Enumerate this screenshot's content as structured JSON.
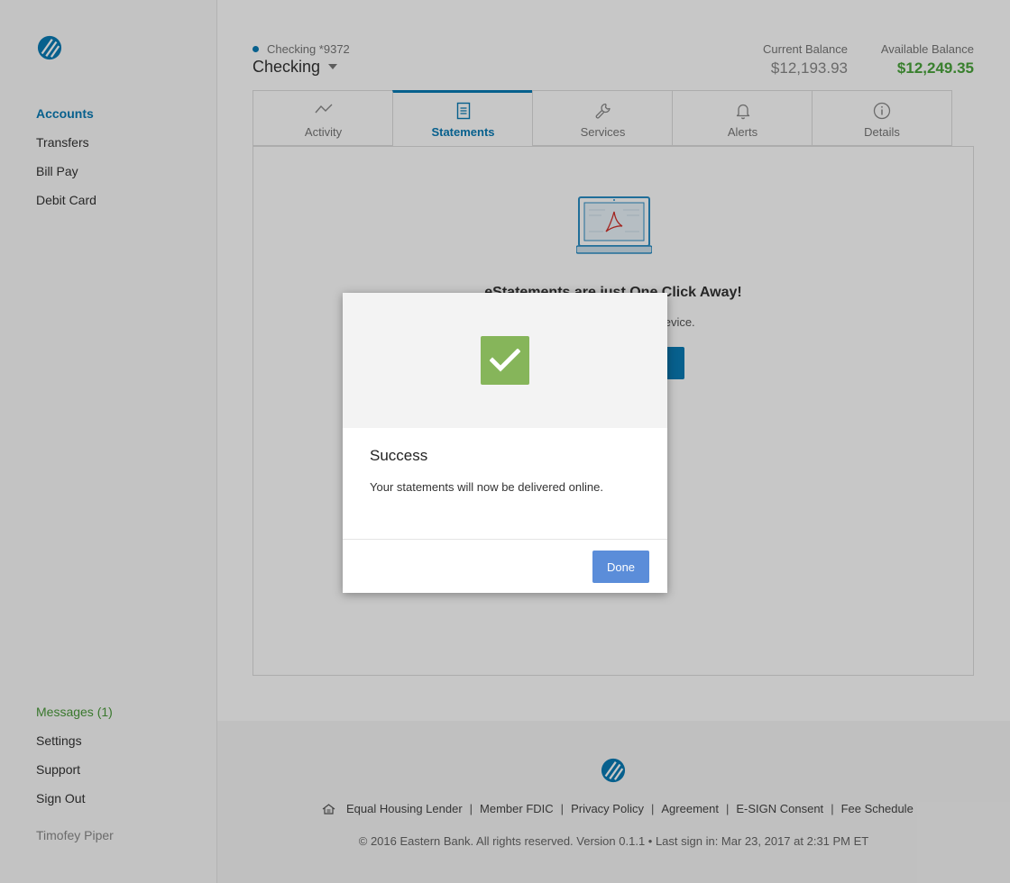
{
  "sidebar": {
    "logo_icon": "eastern-bank-logo",
    "nav": [
      "Accounts",
      "Transfers",
      "Bill Pay",
      "Debit Card"
    ],
    "bottom_nav": [
      "Messages (1)",
      "Settings",
      "Support",
      "Sign Out"
    ],
    "user_name": "Timofey Piper"
  },
  "account": {
    "subtitle": "Checking *9372",
    "title": "Checking",
    "current_balance_label": "Current Balance",
    "current_balance": "$12,193.93",
    "available_balance_label": "Available Balance",
    "available_balance": "$12,249.35"
  },
  "tabs": [
    {
      "label": "Activity",
      "icon": "activity-icon"
    },
    {
      "label": "Statements",
      "icon": "document-icon",
      "active": true
    },
    {
      "label": "Services",
      "icon": "wrench-icon"
    },
    {
      "label": "Alerts",
      "icon": "bell-icon"
    },
    {
      "label": "Details",
      "icon": "info-icon"
    }
  ],
  "panel": {
    "heading": "eStatements are just One Click Away!",
    "text": "here, anytime, from any device."
  },
  "footer": {
    "links": [
      "Equal Housing Lender",
      "Member FDIC",
      "Privacy Policy",
      "Agreement",
      "E-SIGN Consent",
      "Fee Schedule"
    ],
    "copyright": "© 2016 Eastern Bank. All rights reserved. Version 0.1.1 • Last sign in: Mar 23, 2017 at 2:31 PM ET"
  },
  "modal": {
    "title": "Success",
    "message": "Your statements will now be delivered online.",
    "done_label": "Done"
  },
  "colors": {
    "accent": "#0a7bb5",
    "success": "#86b55a",
    "positive_balance": "#49a43b",
    "done_button": "#5b8dd9"
  }
}
